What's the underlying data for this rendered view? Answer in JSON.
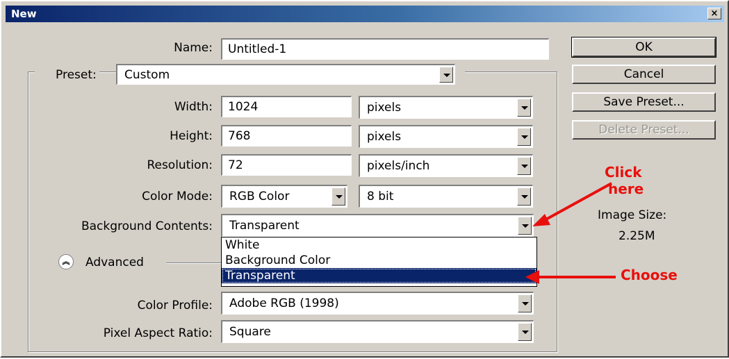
{
  "window": {
    "title": "New",
    "close_label": "×"
  },
  "name": {
    "label": "Name:",
    "value": "Untitled-1"
  },
  "preset": {
    "label": "Preset:",
    "value": "Custom"
  },
  "width": {
    "label": "Width:",
    "value": "1024",
    "unit": "pixels"
  },
  "height": {
    "label": "Height:",
    "value": "768",
    "unit": "pixels"
  },
  "resolution": {
    "label": "Resolution:",
    "value": "72",
    "unit": "pixels/inch"
  },
  "color_mode": {
    "label": "Color Mode:",
    "value": "RGB Color",
    "depth": "8 bit"
  },
  "background": {
    "label": "Background Contents:",
    "value": "Transparent",
    "options": [
      "White",
      "Background Color",
      "Transparent"
    ],
    "selected_option": "Transparent"
  },
  "advanced": {
    "label": "Advanced",
    "icon": "chevron-up-double-icon"
  },
  "color_profile": {
    "label": "Color Profile:",
    "value": "Adobe RGB (1998)"
  },
  "pixel_aspect": {
    "label": "Pixel Aspect Ratio:",
    "value": "Square"
  },
  "buttons": {
    "ok": "OK",
    "cancel": "Cancel",
    "save_preset": "Save Preset...",
    "delete_preset": "Delete Preset..."
  },
  "image_size": {
    "label": "Image Size:",
    "value": "2.25M"
  },
  "annotations": {
    "click_line1": "Click",
    "click_line2": "here",
    "choose": "Choose",
    "color": "#e8100d"
  }
}
